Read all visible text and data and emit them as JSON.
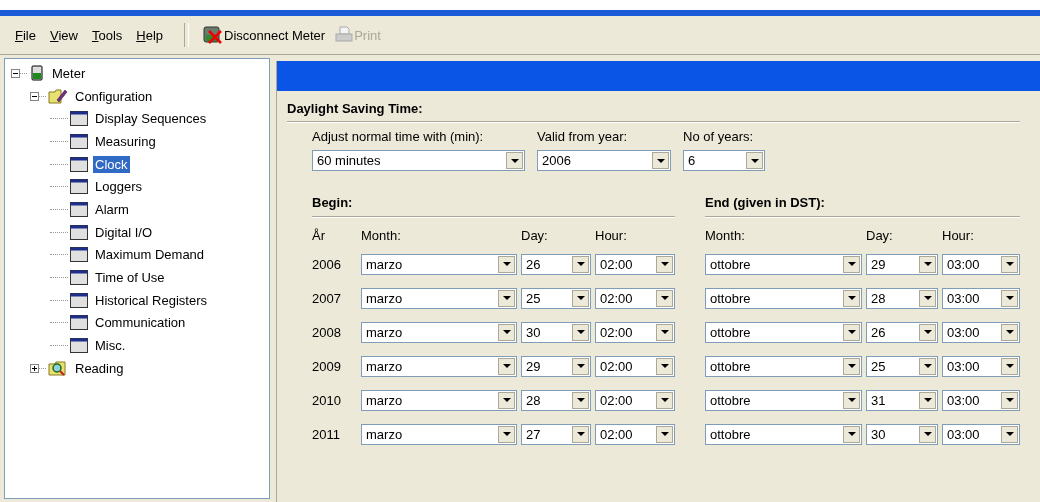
{
  "menu": [
    {
      "label": "File"
    },
    {
      "label": "View"
    },
    {
      "label": "Tools"
    },
    {
      "label": "Help"
    }
  ],
  "toolbar": [
    {
      "kind": "disconnect",
      "label": "Disconnect Meter",
      "disabled": false
    },
    {
      "kind": "print",
      "label": "Print",
      "disabled": true
    }
  ],
  "tree": [
    {
      "kind": "meter",
      "label": "Meter",
      "expanded": true,
      "selected": false,
      "children": [
        {
          "kind": "config",
          "label": "Configuration",
          "expanded": true,
          "selected": false,
          "children": [
            {
              "kind": "page",
              "label": "Display Sequences",
              "selected": false
            },
            {
              "kind": "page",
              "label": "Measuring",
              "selected": false
            },
            {
              "kind": "page",
              "label": "Clock",
              "selected": true
            },
            {
              "kind": "page",
              "label": "Loggers",
              "selected": false
            },
            {
              "kind": "page",
              "label": "Alarm",
              "selected": false
            },
            {
              "kind": "page",
              "label": "Digital I/O",
              "selected": false
            },
            {
              "kind": "page",
              "label": "Maximum Demand",
              "selected": false
            },
            {
              "kind": "page",
              "label": "Time of Use",
              "selected": false
            },
            {
              "kind": "page",
              "label": "Historical Registers",
              "selected": false
            },
            {
              "kind": "page",
              "label": "Communication",
              "selected": false
            },
            {
              "kind": "page",
              "label": "Misc.",
              "selected": false
            }
          ]
        },
        {
          "kind": "reading",
          "label": "Reading",
          "expanded": false,
          "selected": false
        }
      ]
    }
  ],
  "dst": {
    "title": "Daylight Saving Time:",
    "fields": [
      {
        "label": "Adjust normal time with (min):",
        "value": "60 minutes"
      },
      {
        "label": "Valid from year:",
        "value": "2006"
      },
      {
        "label": "No of years:",
        "value": "6"
      }
    ],
    "begin_title": "Begin:",
    "end_title": "End (given in DST):",
    "year_header": "År",
    "begin_headers": {
      "month": "Month:",
      "day": "Day:",
      "hour": "Hour:"
    },
    "end_headers": {
      "month": "Month:",
      "day": "Day:",
      "hour": "Hour:"
    },
    "rows": [
      {
        "year": "2006",
        "begin": {
          "month": "marzo",
          "day": "26",
          "hour": "02:00"
        },
        "end": {
          "month": "ottobre",
          "day": "29",
          "hour": "03:00"
        }
      },
      {
        "year": "2007",
        "begin": {
          "month": "marzo",
          "day": "25",
          "hour": "02:00"
        },
        "end": {
          "month": "ottobre",
          "day": "28",
          "hour": "03:00"
        }
      },
      {
        "year": "2008",
        "begin": {
          "month": "marzo",
          "day": "30",
          "hour": "02:00"
        },
        "end": {
          "month": "ottobre",
          "day": "26",
          "hour": "03:00"
        }
      },
      {
        "year": "2009",
        "begin": {
          "month": "marzo",
          "day": "29",
          "hour": "02:00"
        },
        "end": {
          "month": "ottobre",
          "day": "25",
          "hour": "03:00"
        }
      },
      {
        "year": "2010",
        "begin": {
          "month": "marzo",
          "day": "28",
          "hour": "02:00"
        },
        "end": {
          "month": "ottobre",
          "day": "31",
          "hour": "03:00"
        }
      },
      {
        "year": "2011",
        "begin": {
          "month": "marzo",
          "day": "27",
          "hour": "02:00"
        },
        "end": {
          "month": "ottobre",
          "day": "30",
          "hour": "03:00"
        }
      }
    ]
  }
}
